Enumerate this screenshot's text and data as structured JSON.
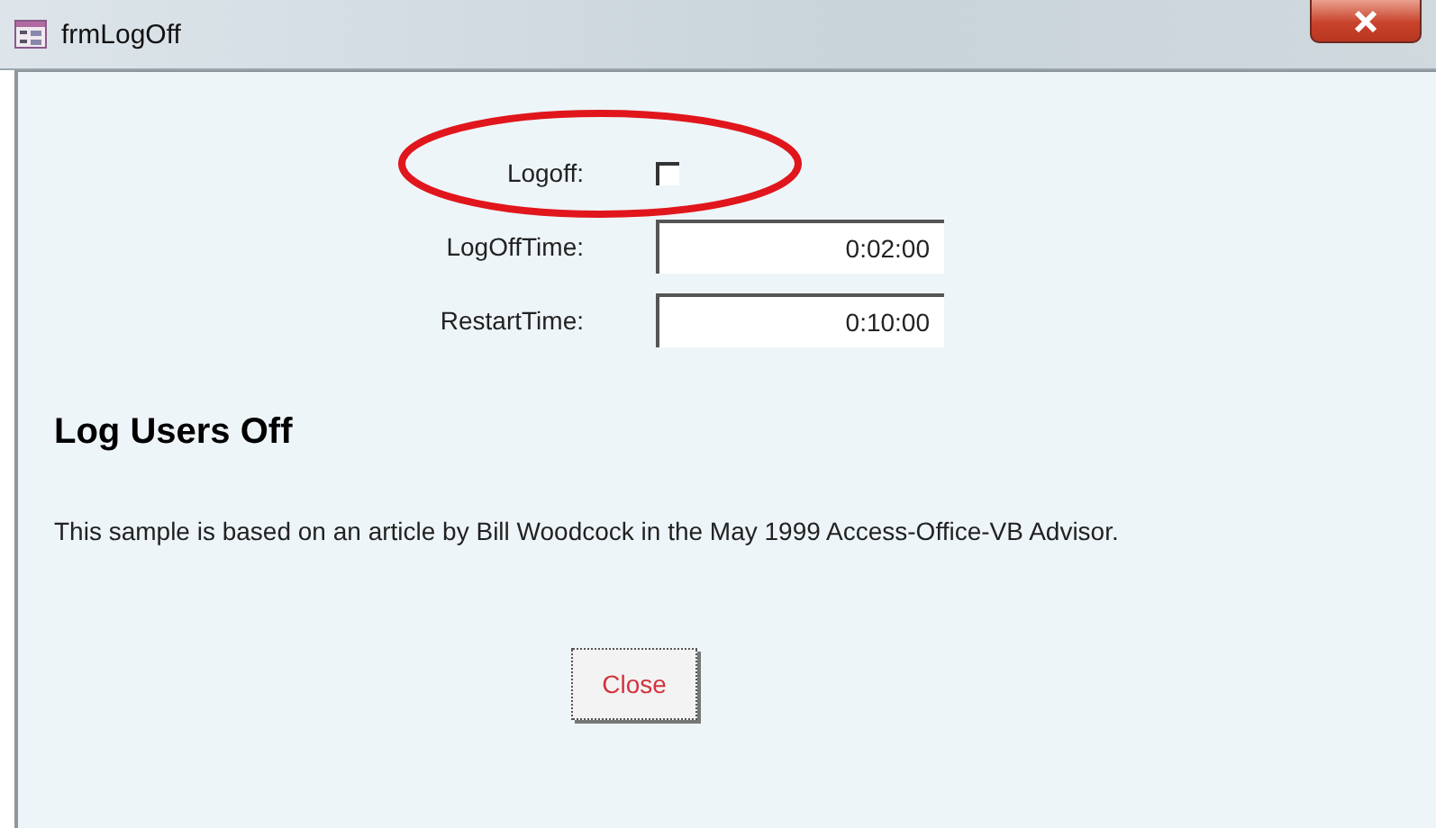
{
  "window": {
    "title": "frmLogOff"
  },
  "fields": [
    {
      "kind": "checkbox",
      "label": "Logoff:",
      "checked": false
    },
    {
      "kind": "text",
      "label": "LogOffTime:",
      "value": "0:02:00"
    },
    {
      "kind": "text",
      "label": "RestartTime:",
      "value": "0:10:00"
    }
  ],
  "heading": "Log Users Off",
  "description": "This sample is based on an article by Bill Woodcock in the May 1999 Access-Office-VB Advisor.",
  "buttons": [
    {
      "label": "Close"
    }
  ]
}
